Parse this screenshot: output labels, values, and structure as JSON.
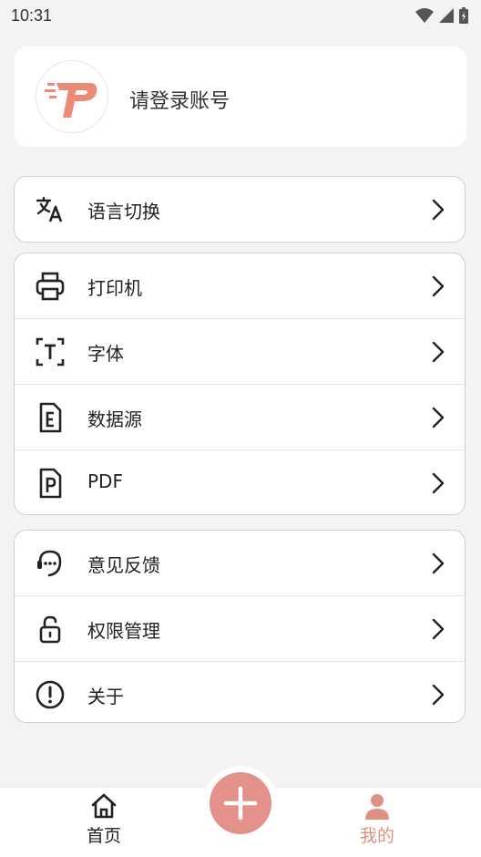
{
  "status": {
    "time": "10:31"
  },
  "profile": {
    "login_prompt": "请登录账号"
  },
  "groups": [
    {
      "items": [
        {
          "label": "语言切换",
          "icon": "translate-icon"
        }
      ]
    },
    {
      "items": [
        {
          "label": "打印机",
          "icon": "printer-icon"
        },
        {
          "label": "字体",
          "icon": "font-icon"
        },
        {
          "label": "数据源",
          "icon": "data-source-icon"
        },
        {
          "label": "PDF",
          "icon": "pdf-icon"
        }
      ]
    },
    {
      "items": [
        {
          "label": "意见反馈",
          "icon": "feedback-icon"
        },
        {
          "label": "权限管理",
          "icon": "permission-icon"
        },
        {
          "label": "关于",
          "icon": "about-icon"
        }
      ]
    }
  ],
  "bottom_nav": {
    "home": {
      "label": "首页",
      "icon": "home-icon"
    },
    "add": {
      "icon": "plus-icon"
    },
    "mine": {
      "label": "我的",
      "icon": "person-icon",
      "active": true
    }
  },
  "colors": {
    "accent": "#e3918a",
    "active_tab": "#e08f83",
    "background": "#f3f3f3"
  }
}
